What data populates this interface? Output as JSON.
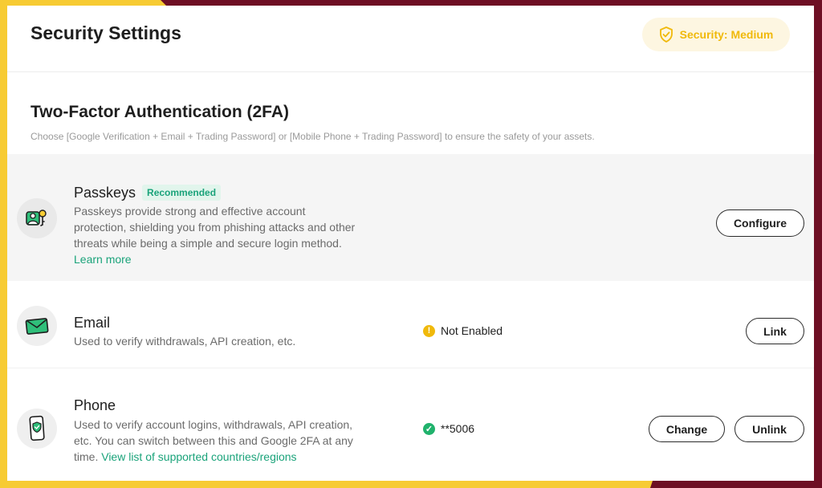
{
  "header": {
    "title": "Security Settings",
    "security_level": "Security: Medium"
  },
  "section": {
    "title": "Two-Factor Authentication (2FA)",
    "description": "Choose [Google Verification + Email + Trading Password] or [Mobile Phone + Trading Password] to ensure the safety of your assets."
  },
  "methods": [
    {
      "title": "Passkeys",
      "tag": "Recommended",
      "desc_line1": "Passkeys provide strong and effective account",
      "desc_line2": "protection, shielding you from phishing attacks and other",
      "desc_line3": "threats while being a simple and secure login method.",
      "link": "Learn more",
      "button": "Configure",
      "icon": "passkey-icon"
    },
    {
      "title": "Email",
      "desc_line1": "Used to verify withdrawals, API creation, etc.",
      "status": "Not Enabled",
      "status_color": "#f0b90b",
      "button": "Link",
      "icon": "email-icon"
    },
    {
      "title": "Phone",
      "desc_line1": "Used to verify account logins, withdrawals, API creation,",
      "desc_line2": "etc. You can switch between this and Google 2FA at any",
      "desc_line3_prefix": "time.",
      "link": "View list of supported countries/regions",
      "status": "**5006",
      "status_color": "#20b26c",
      "button_change": "Change",
      "button_unlink": "Unlink",
      "icon": "phone-icon"
    }
  ],
  "colors": {
    "accent_green": "#1aa37a",
    "warning_yellow": "#f0b90b",
    "frame_yellow": "#f7cb33",
    "frame_maroon": "#6e0f24"
  }
}
